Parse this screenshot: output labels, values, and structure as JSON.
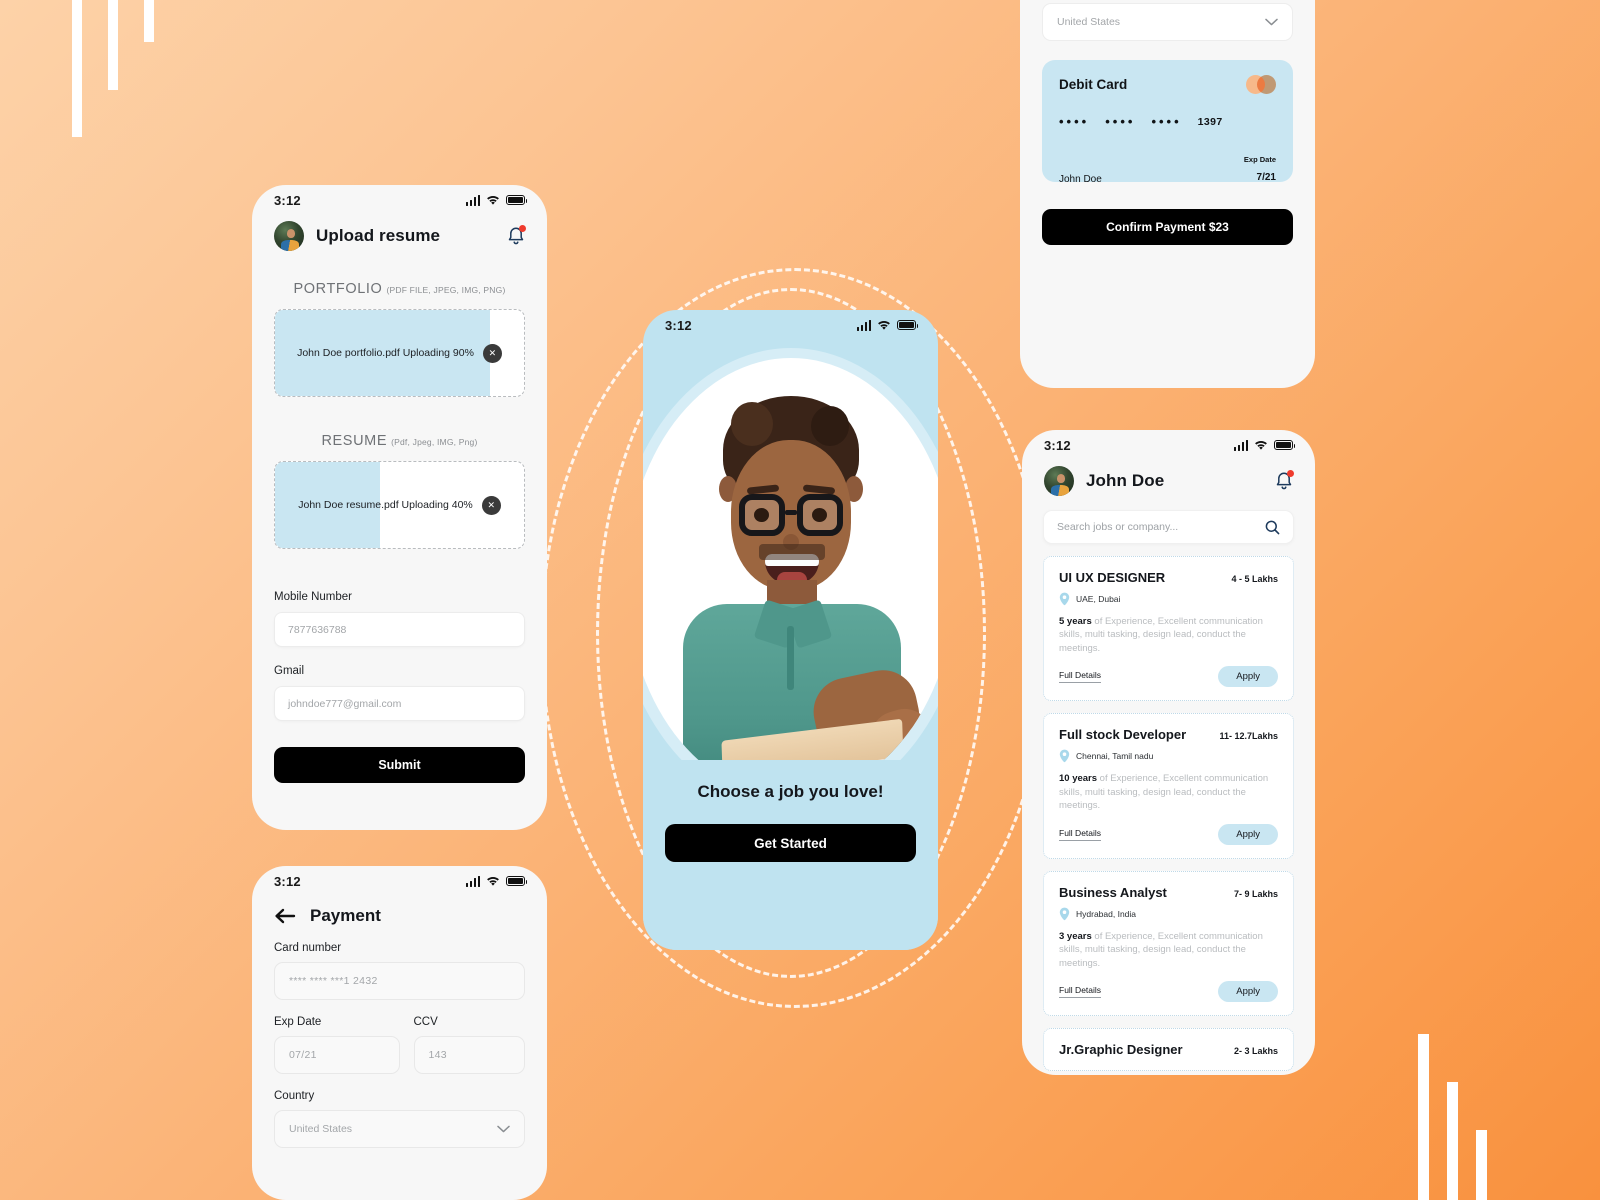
{
  "background": {
    "gradient_start": "#FDD2A8",
    "gradient_end": "#F9913E",
    "accent_light_blue": "#C9E6F2"
  },
  "status_bar": {
    "time": "3:12"
  },
  "upload_screen": {
    "header_title": "Upload resume",
    "portfolio": {
      "label_main": "PORTFOLIO",
      "label_formats": "(PDF FILE, JPEG, IMG, PNG)",
      "file_text": "John Doe portfolio.pdf Uploading 90%",
      "progress": 90
    },
    "resume": {
      "label_main": "RESUME",
      "label_formats": "(Pdf, Jpeg, IMG, Png)",
      "file_text": "John Doe resume.pdf Uploading 40%",
      "progress": 40
    },
    "mobile_label": "Mobile Number",
    "mobile_value": "7877636788",
    "gmail_label": "Gmail",
    "gmail_value": "johndoe777@gmail.com",
    "submit_label": "Submit"
  },
  "payment_screen": {
    "title": "Payment",
    "card_number_label": "Card number",
    "card_number_value": "**** **** ***1 2432",
    "exp_label": "Exp Date",
    "exp_value": "07/21",
    "ccv_label": "CCV",
    "ccv_value": "143",
    "country_label": "Country",
    "country_value": "United States"
  },
  "confirm_screen": {
    "country_value": "United States",
    "card": {
      "title": "Debit Card",
      "group1": "••••",
      "group2": "••••",
      "group3": "••••",
      "last4": "1397",
      "holder": "John Doe",
      "exp_label": "Exp Date",
      "exp_value": "7/21"
    },
    "confirm_label": "Confirm Payment $23"
  },
  "jobs_screen": {
    "user_name": "John Doe",
    "search_placeholder": "Search jobs or company...",
    "jobs": [
      {
        "title": "UI UX DESIGNER",
        "salary": "4 - 5 Lakhs",
        "location": "UAE, Dubai",
        "experience": "5 years",
        "description": " of Experience, Excellent communication skills, multi tasking, design lead, conduct the meetings.",
        "details_label": "Full Details",
        "apply_label": "Apply"
      },
      {
        "title": "Full stock Developer",
        "salary": "11- 12.7Lakhs",
        "location": "Chennai, Tamil nadu",
        "experience": "10 years",
        "description": " of Experience, Excellent communication skills, multi tasking, design lead, conduct the meetings.",
        "details_label": "Full Details",
        "apply_label": "Apply"
      },
      {
        "title": "Business Analyst",
        "salary": "7- 9 Lakhs",
        "location": "Hydrabad, India",
        "experience": "3 years",
        "description": " of Experience, Excellent communication skills, multi tasking, design lead, conduct the meetings.",
        "details_label": "Full Details",
        "apply_label": "Apply"
      },
      {
        "title": "Jr.Graphic Designer",
        "salary": "2- 3 Lakhs",
        "location": "",
        "experience": "",
        "description": "",
        "details_label": "",
        "apply_label": ""
      }
    ]
  },
  "onboarding_screen": {
    "tagline": "Choose a job you love!",
    "cta_label": "Get Started"
  }
}
